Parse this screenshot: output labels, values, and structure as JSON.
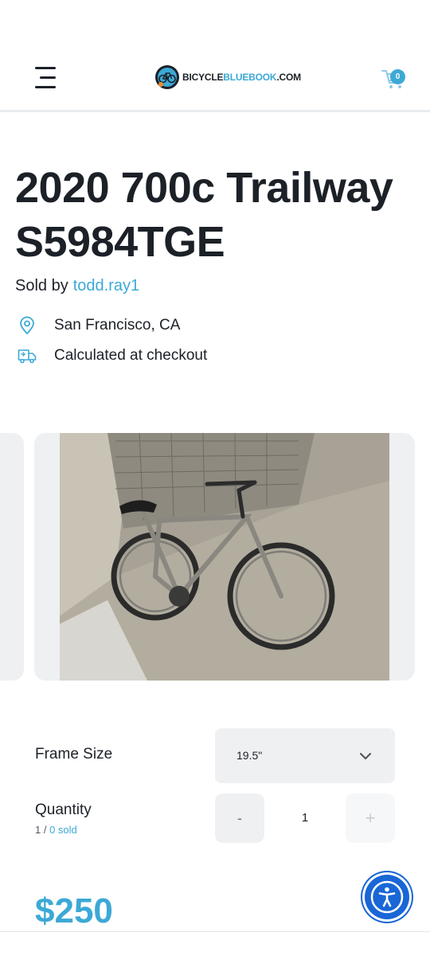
{
  "header": {
    "logo_prefix": "BICYCLE",
    "logo_highlight": "BLUEBOOK",
    "logo_suffix": ".COM",
    "cart_count": "0"
  },
  "product": {
    "title": "2020 700c Trailway S5984TGE",
    "sold_by_label": "Sold by",
    "seller": "todd.ray1",
    "location": "San Francisco, CA",
    "shipping": "Calculated at checkout"
  },
  "options": {
    "frame_size_label": "Frame Size",
    "frame_size_value": "19.5\"",
    "quantity_label": "Quantity",
    "quantity_available": "1 /",
    "quantity_sold": "0 sold",
    "minus_label": "-",
    "quantity_value": "1",
    "plus_label": "+"
  },
  "price": "$250",
  "colors": {
    "accent": "#3ca9d6",
    "text": "#1c2128",
    "accessibility_button": "#1a66d6"
  },
  "icons": [
    "menu-icon",
    "cart-icon",
    "location-pin-icon",
    "delivery-truck-icon",
    "chevron-down-icon",
    "accessibility-icon"
  ]
}
